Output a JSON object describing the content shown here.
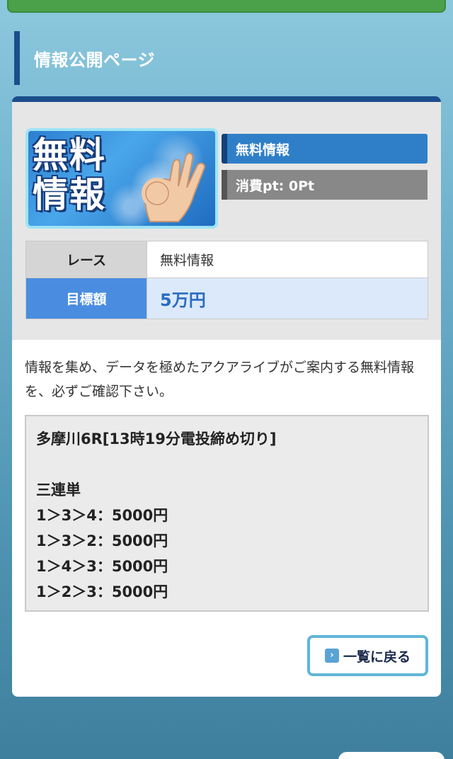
{
  "page_title": "情報公開ページ",
  "thumbnail": {
    "line1": "無料",
    "line2": "情報",
    "icon": "ok-hand-icon"
  },
  "tags": {
    "category": "無料情報",
    "points": "消費pt: 0Pt"
  },
  "table": {
    "race_label": "レース",
    "race_value": "無料情報",
    "target_label": "目標額",
    "target_value": "5万円"
  },
  "description": "情報を集め、データを極めたアクアライブがご案内する無料情報を、必ずご確認下さい。",
  "result": {
    "header": "多摩川6R[13時19分電投締め切り]",
    "bet_type": "三連単",
    "bets": [
      "1＞3＞4：5000円",
      "1＞3＞2：5000円",
      "1＞4＞3：5000円",
      "1＞2＞3：5000円"
    ]
  },
  "back_button": {
    "label": "一覧に戻る",
    "icon": "chevron-right-icon"
  },
  "colors": {
    "accent": "#1b4e8c",
    "tag_blue": "#2f7fc8",
    "target_blue": "#4a8de0",
    "top_bar_green": "#4aa14a"
  }
}
